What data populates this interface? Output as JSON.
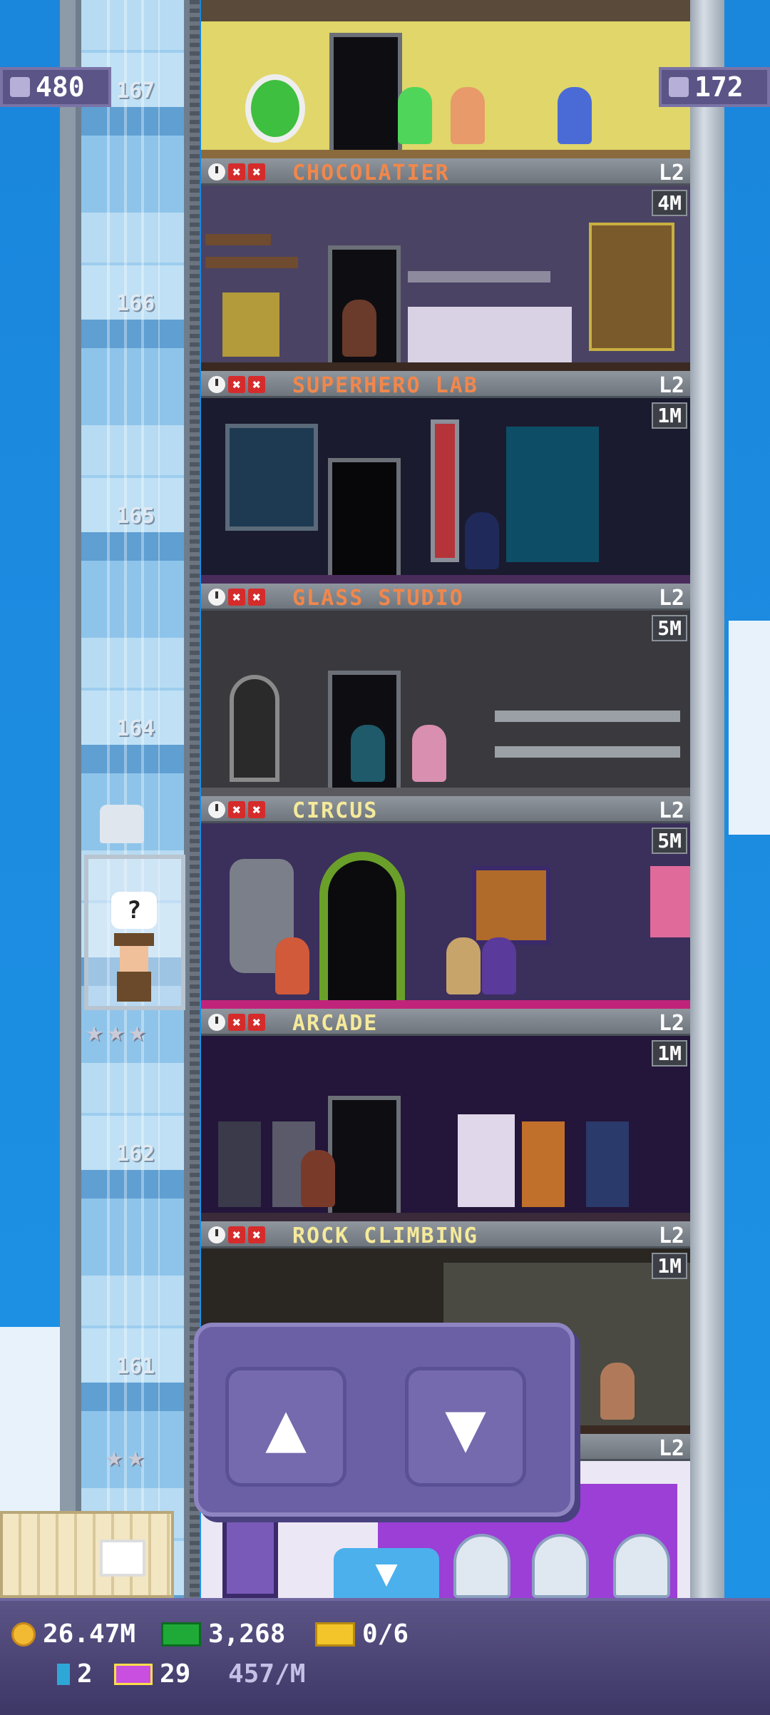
{
  "top": {
    "population": "480",
    "floors": "172"
  },
  "shaft": {
    "labels": [
      "167",
      "166",
      "165",
      "164",
      "162",
      "161"
    ]
  },
  "floors": [
    {
      "name": "CHOCOLATIER",
      "level": "L2",
      "stock": "4M",
      "name_color": "#f1874b"
    },
    {
      "name": "SUPERHERO LAB",
      "level": "L2",
      "stock": "1M",
      "name_color": "#f1874b"
    },
    {
      "name": "GLASS STUDIO",
      "level": "L2",
      "stock": "5M",
      "name_color": "#f1874b"
    },
    {
      "name": "CIRCUS",
      "level": "L2",
      "stock": "5M",
      "name_color": "#f5ea9a"
    },
    {
      "name": "ARCADE",
      "level": "L2",
      "stock": "1M",
      "name_color": "#f5ea9a"
    },
    {
      "name": "ROCK CLIMBING",
      "level": "L2",
      "stock": "1M",
      "name_color": "#f5ea9a"
    }
  ],
  "lobby_level": "L2",
  "elevator": {
    "bubble": "?"
  },
  "controls": {
    "up": "▲",
    "down": "▼"
  },
  "status": {
    "coins": "26.47M",
    "bux": "3,268",
    "tickets": "0/6",
    "books": "2",
    "tv": "29",
    "rate": "457/M"
  },
  "icons": {
    "population": "person-icon",
    "floors": "building-icon",
    "coin": "coin-icon",
    "bux": "bux-icon",
    "ticket": "ticket-icon"
  }
}
